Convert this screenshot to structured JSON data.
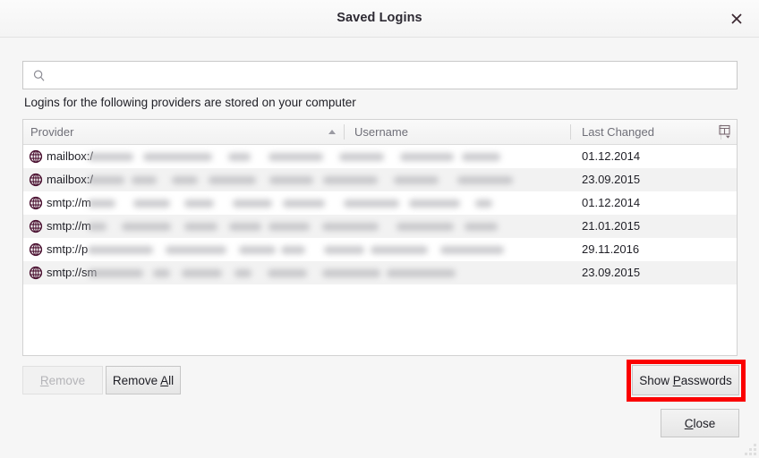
{
  "window": {
    "title": "Saved Logins",
    "close_icon": "close-x-icon"
  },
  "search": {
    "icon": "search-icon",
    "value": "",
    "placeholder": ""
  },
  "description": "Logins for the following providers are stored on your computer",
  "table": {
    "columns": [
      {
        "key": "provider",
        "label": "Provider",
        "sorted": "ascending",
        "sort_icon": "sort-ascending-triangle-icon"
      },
      {
        "key": "username",
        "label": "Username"
      },
      {
        "key": "last_changed",
        "label": "Last Changed"
      }
    ],
    "column_picker_icon": "column-chooser-icon",
    "rows": [
      {
        "icon": "globe-icon",
        "provider": "mailbox:/",
        "username": "",
        "last_changed": "01.12.2014",
        "redacted": true
      },
      {
        "icon": "globe-icon",
        "provider": "mailbox:/",
        "username": "",
        "last_changed": "23.09.2015",
        "redacted": true
      },
      {
        "icon": "globe-icon",
        "provider": "smtp://m",
        "username": "",
        "last_changed": "01.12.2014",
        "redacted": true
      },
      {
        "icon": "globe-icon",
        "provider": "smtp://m",
        "username": "",
        "last_changed": "21.01.2015",
        "redacted": true
      },
      {
        "icon": "globe-icon",
        "provider": "smtp://p",
        "username": "",
        "last_changed": "29.11.2016",
        "redacted": true
      },
      {
        "icon": "globe-icon",
        "provider": "smtp://sm",
        "username": "",
        "last_changed": "23.09.2015",
        "redacted": true
      }
    ]
  },
  "buttons": {
    "remove": {
      "label": "Remove",
      "accelerator": "R",
      "enabled": false
    },
    "remove_all": {
      "label": "Remove All",
      "accelerator": "A",
      "enabled": true
    },
    "show_passwords": {
      "label": "Show Passwords",
      "accelerator": "P",
      "enabled": true,
      "highlighted": true
    },
    "close": {
      "label": "Close",
      "accelerator": "C",
      "enabled": true
    }
  },
  "colors": {
    "highlight_box": "#fb0000",
    "globe_icon": "#4a1030",
    "dialog_background": "#f6f6f6",
    "list_background": "#ffffff",
    "row_alt_background": "#f2f2f2"
  }
}
